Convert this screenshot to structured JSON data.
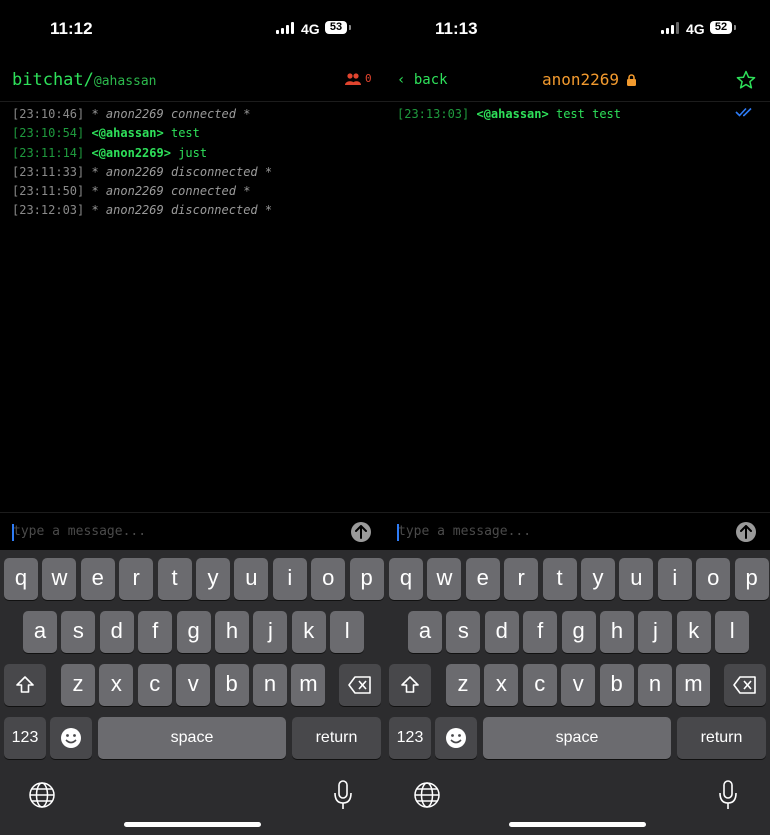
{
  "left": {
    "status": {
      "time": "11:12",
      "network": "4G",
      "battery": "53"
    },
    "header": {
      "app_name": "bitchat/",
      "username": "@ahassan",
      "peer_count": "0"
    },
    "messages": [
      {
        "ts": "[23:10:46]",
        "kind": "system",
        "text": "* anon2269 connected *"
      },
      {
        "ts": "[23:10:54]",
        "kind": "chat",
        "sender": "<@ahassan>",
        "text": "test"
      },
      {
        "ts": "[23:11:14]",
        "kind": "chat",
        "sender": "<@anon2269>",
        "text": "just"
      },
      {
        "ts": "[23:11:33]",
        "kind": "system",
        "text": "* anon2269 disconnected *"
      },
      {
        "ts": "[23:11:50]",
        "kind": "system",
        "text": "* anon2269 connected *"
      },
      {
        "ts": "[23:12:03]",
        "kind": "system",
        "text": "* anon2269 disconnected *"
      }
    ],
    "input": {
      "placeholder": "type a message..."
    }
  },
  "right": {
    "status": {
      "time": "11:13",
      "network": "4G",
      "battery": "52"
    },
    "header": {
      "back_label": "back",
      "peer_name": "anon2269"
    },
    "messages": [
      {
        "ts": "[23:13:03]",
        "kind": "chat",
        "sender": "<@ahassan>",
        "text": "test test"
      }
    ],
    "input": {
      "placeholder": "type a message..."
    }
  },
  "keyboard": {
    "row1": [
      "q",
      "w",
      "e",
      "r",
      "t",
      "y",
      "u",
      "i",
      "o",
      "p"
    ],
    "row2": [
      "a",
      "s",
      "d",
      "f",
      "g",
      "h",
      "j",
      "k",
      "l"
    ],
    "row3": [
      "z",
      "x",
      "c",
      "v",
      "b",
      "n",
      "m"
    ],
    "numbers_label": "123",
    "space_label": "space",
    "return_label": "return"
  },
  "colors": {
    "accent_green": "#2ee05a",
    "peer_orange": "#f29a2e",
    "alert_red": "#e0442e",
    "caret_blue": "#2e7cf6"
  },
  "icons": [
    "signal-icon",
    "battery-icon",
    "people-icon",
    "lock-icon",
    "star-icon",
    "double-check-icon",
    "send-icon",
    "shift-icon",
    "backspace-icon",
    "emoji-icon",
    "globe-icon",
    "mic-icon"
  ]
}
